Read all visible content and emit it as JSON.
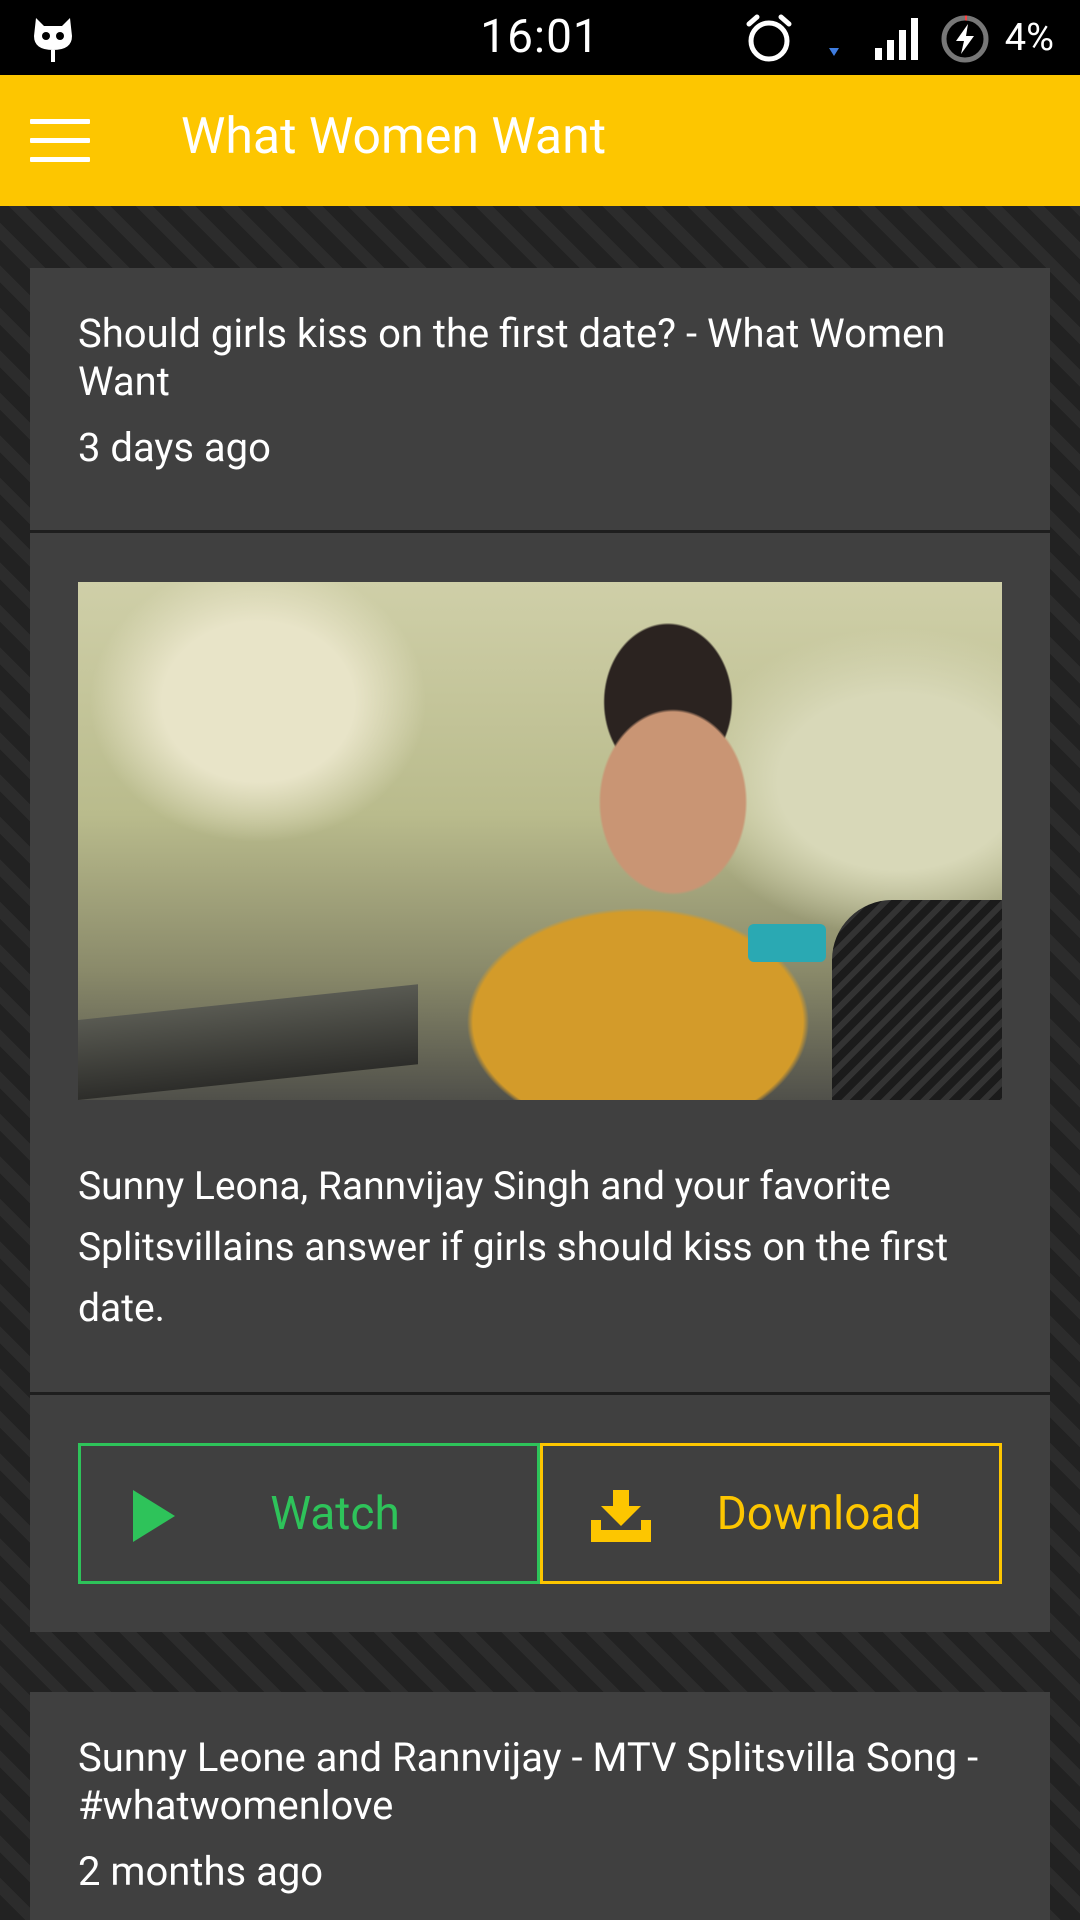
{
  "status_bar": {
    "time": "16:01",
    "battery_text": "4%",
    "icons": [
      "cyanogen-icon",
      "alarm-icon",
      "data-arrow-icon",
      "signal-icon",
      "battery-charging-icon"
    ]
  },
  "app_bar": {
    "title": "What Women Want",
    "menu_icon": "hamburger-menu-icon",
    "background_color": "#fdc600"
  },
  "cards": [
    {
      "headline": "Should girls kiss on the first date? - What Women Want",
      "time_ago": "3 days ago",
      "description": "Sunny Leona, Rannvijay Singh and your favorite Splitsvillains answer if girls should kiss on the first date.",
      "watch_label": "Watch",
      "download_label": "Download"
    },
    {
      "headline": "Sunny Leone and Rannvijay - MTV Splitsvilla Song - #whatwomenlove",
      "time_ago": "2 months ago"
    }
  ],
  "colors": {
    "accent_yellow": "#fdc600",
    "watch_green": "#2ec35a",
    "card_bg": "#404040"
  }
}
